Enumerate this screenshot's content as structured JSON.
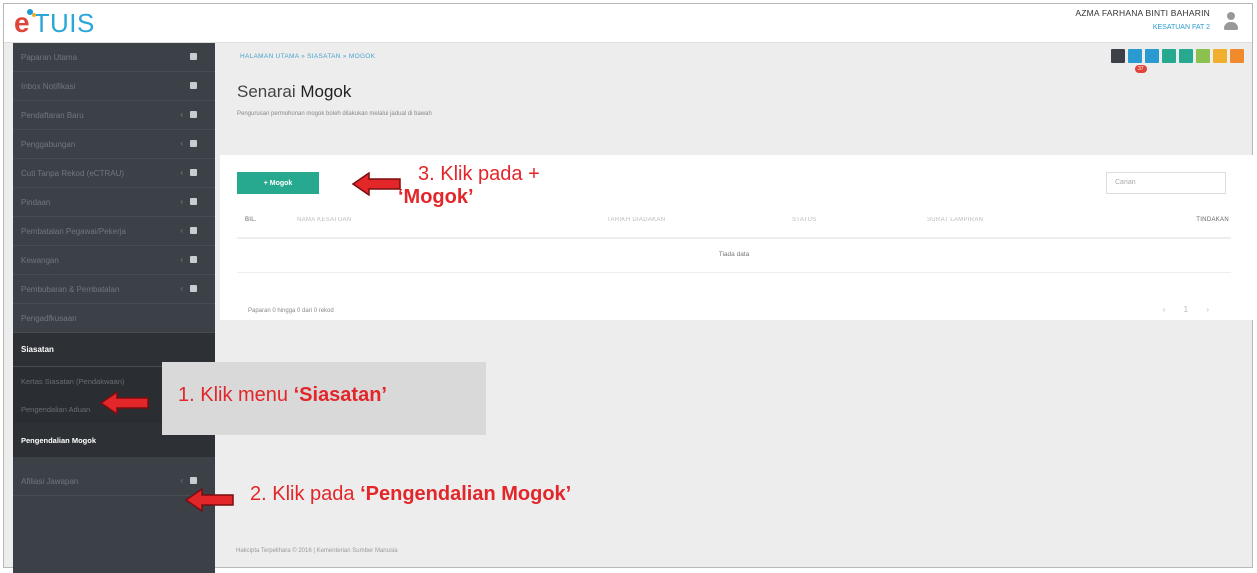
{
  "app": {
    "logo_e": "e",
    "logo_text": "TUIS"
  },
  "user": {
    "name": "AZMA FARHANA BINTI BAHARIN",
    "role": "KESATUAN FAT 2"
  },
  "sidebar": {
    "items": [
      {
        "label": "Paparan Utama"
      },
      {
        "label": "Inbox Notifikasi"
      },
      {
        "label": "Pendaftaran Baru"
      },
      {
        "label": "Penggabungan"
      },
      {
        "label": "Cuti Tanpa Rekod (eCTRAU)"
      },
      {
        "label": "Pindaan"
      },
      {
        "label": "Pembatalan Pegawai/Pekerja"
      },
      {
        "label": "Kewangan"
      },
      {
        "label": "Pembubaran & Pembatalan"
      },
      {
        "label": "Pengadfkusaan"
      },
      {
        "label": "Siasatan"
      }
    ],
    "sub_items": [
      {
        "label": "Kertas Siasatan (Pendakwaan)"
      },
      {
        "label": "Pengendalian Aduan"
      },
      {
        "label": "Pengendalian Mogok"
      }
    ],
    "last_item": {
      "label": "Afiliasi Jawapan"
    }
  },
  "breadcrumb": "HALAMAN UTAMA  »  SIASATAN  »  MOGOK",
  "page": {
    "title_prefix": "Senarai",
    "title_main": "Mogok",
    "subtitle": "Pengurusan permohonan mogok boleh dilakukan melalui jadual di bawah"
  },
  "toolbar": {
    "badge": "37",
    "colors": [
      "#3c4147",
      "#2a9bd0",
      "#2a9bd0",
      "#26a98f",
      "#26a98f",
      "#8cc152",
      "#f0b02d",
      "#f08a2d"
    ]
  },
  "actions": {
    "add_mogok": "+ Mogok",
    "search_placeholder": "Carian"
  },
  "table": {
    "headers": [
      "BIL.",
      "NAMA KESATUAN",
      "TARIKH DIADAKAN",
      "STATUS",
      "SURAT LAMPIRAN",
      "TINDAKAN"
    ],
    "empty": "Tiada data",
    "info": "Paparan 0 hingga 0 dari 0 rekod",
    "pager": "‹ 1 ›"
  },
  "footer": "Hakcipta Terpelihara © 2016 | Kementerian Sumber Manusia",
  "annotations": {
    "step1_prefix": "1. Klik menu ",
    "step1_bold": "‘Siasatan’",
    "step2_prefix": "2. Klik pada ",
    "step2_bold": "‘Pengendalian Mogok’",
    "step3_line1": "3. Klik pada +",
    "step3_bold": "‘Mogok’",
    "color": "#e3262a"
  }
}
